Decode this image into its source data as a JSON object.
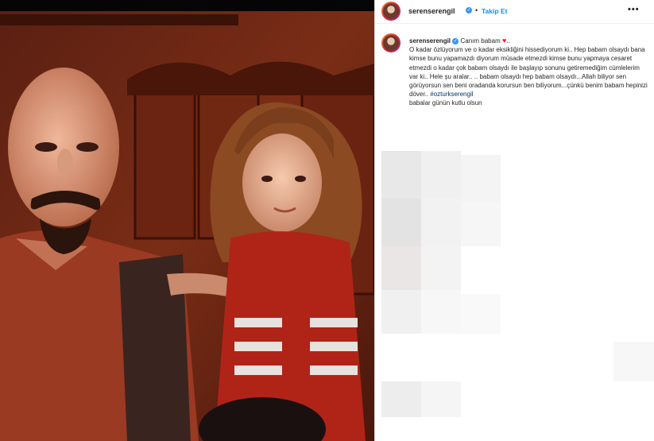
{
  "post": {
    "username": "serenserengil",
    "follow_label": "Takip Et",
    "separator": "•",
    "more_label": "•••"
  },
  "caption": {
    "username": "serenserengil",
    "first_line": "Canım babam",
    "heart": "♥",
    "body": "O kadar özlüyorum ve o kadar eksikliğini hissediyorum ki.. Hep babam olsaydı bana kimse bunu yapamazdı diyorum müsade etmezdi kimse bunu yapmaya cesaret etmezdi o kadar çok babam olsaydı ile başlayıp sonunu getiremediğim cümlelerim var ki.. Hele şu aralar.. .. babam olsaydı hep babam olsaydı...Allah biliyor sen görüyorsun sen beni oradanda korursun ben biliyorum...çünkü benim babam hepinizi döver..",
    "hashtag": "#ozturkserengil",
    "last_line": "babalar günün kutlu olsun"
  },
  "colors": {
    "link_blue": "#0095f6",
    "verified_blue": "#3897f0",
    "heart_red": "#ed1c24",
    "text": "#262626"
  }
}
